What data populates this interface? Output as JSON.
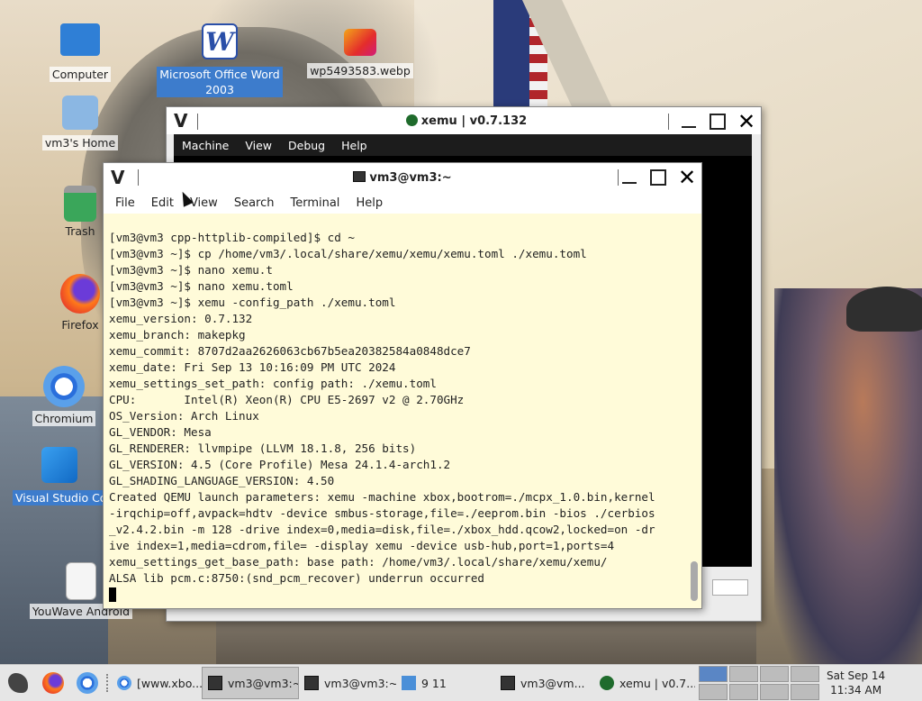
{
  "desktop": {
    "icons": [
      {
        "label": "Computer",
        "icon": "monitor-icon"
      },
      {
        "label": "Microsoft Office Word 2003",
        "icon": "word-icon"
      },
      {
        "label": "wp5493583.webp",
        "icon": "image-file-icon"
      },
      {
        "label": "vm3's Home",
        "icon": "home-folder-icon"
      },
      {
        "label": "Trash",
        "icon": "trash-icon"
      },
      {
        "label": "Firefox",
        "icon": "firefox-icon"
      },
      {
        "label": "Chromium",
        "icon": "chromium-icon"
      },
      {
        "label": "Visual Studio Co",
        "icon": "vscode-icon"
      },
      {
        "label": "YouWave Android",
        "icon": "document-icon"
      }
    ],
    "partial_label": "wp549"
  },
  "xemu_window": {
    "title": "xemu | v0.7.132",
    "menu": [
      "Machine",
      "View",
      "Debug",
      "Help"
    ]
  },
  "terminal_window": {
    "title": "vm3@vm3:~",
    "menu": [
      "File",
      "Edit",
      "View",
      "Search",
      "Terminal",
      "Help"
    ],
    "lines": [
      "[vm3@vm3 cpp-httplib-compiled]$ cd ~",
      "[vm3@vm3 ~]$ cp /home/vm3/.local/share/xemu/xemu/xemu.toml ./xemu.toml",
      "[vm3@vm3 ~]$ nano xemu.t",
      "[vm3@vm3 ~]$ nano xemu.toml",
      "[vm3@vm3 ~]$ xemu -config_path ./xemu.toml",
      "xemu_version: 0.7.132",
      "xemu_branch: makepkg",
      "xemu_commit: 8707d2aa2626063cb67b5ea20382584a0848dce7",
      "xemu_date: Fri Sep 13 10:16:09 PM UTC 2024",
      "xemu_settings_set_path: config path: ./xemu.toml",
      "CPU:       Intel(R) Xeon(R) CPU E5-2697 v2 @ 2.70GHz",
      "OS_Version: Arch Linux",
      "GL_VENDOR: Mesa",
      "GL_RENDERER: llvmpipe (LLVM 18.1.8, 256 bits)",
      "GL_VERSION: 4.5 (Core Profile) Mesa 24.1.4-arch1.2",
      "GL_SHADING_LANGUAGE_VERSION: 4.50",
      "Created QEMU launch parameters: xemu -machine xbox,bootrom=./mcpx_1.0.bin,kernel",
      "-irqchip=off,avpack=hdtv -device smbus-storage,file=./eeprom.bin -bios ./cerbios",
      "_v2.4.2.bin -m 128 -drive index=0,media=disk,file=./xbox_hdd.qcow2,locked=on -dr",
      "ive index=1,media=cdrom,file= -display xemu -device usb-hub,port=1,ports=4",
      "xemu_settings_get_base_path: base path: /home/vm3/.local/share/xemu/xemu/",
      "ALSA lib pcm.c:8750:(snd_pcm_recover) underrun occurred"
    ]
  },
  "taskbar": {
    "items": [
      {
        "label": "[www.xbo...",
        "icon": "chromium-icon"
      },
      {
        "label": "vm3@vm3:~",
        "icon": "terminal-icon",
        "active": true
      },
      {
        "label": "vm3@vm3:~",
        "icon": "terminal-icon"
      },
      {
        "label": "9 11",
        "icon": "folder-icon"
      },
      {
        "label": "vm3@vm...",
        "icon": "terminal-icon"
      },
      {
        "label": "xemu | v0.7...",
        "icon": "xemu-icon"
      }
    ],
    "clock_date": "Sat Sep 14",
    "clock_time": "11:34 AM"
  }
}
